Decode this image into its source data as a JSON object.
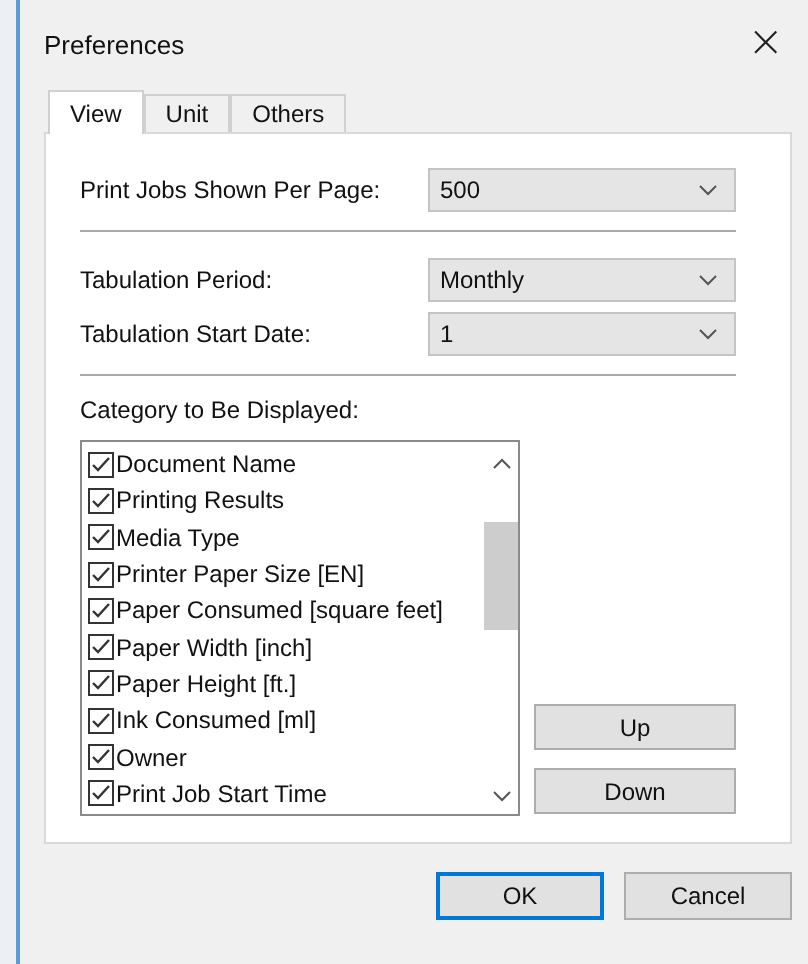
{
  "window": {
    "title": "Preferences",
    "close": "×"
  },
  "tabs": [
    {
      "label": "View",
      "selected": true
    },
    {
      "label": "Unit",
      "selected": false
    },
    {
      "label": "Others",
      "selected": false
    }
  ],
  "setting_groups": [
    [
      {
        "label": "Print Jobs Shown Per Page:",
        "value": "500"
      }
    ],
    [
      {
        "label": "Tabulation Period:",
        "value": "Monthly"
      },
      {
        "label": "Tabulation Start Date:",
        "value": "1"
      }
    ]
  ],
  "category": {
    "label": "Category to Be Displayed:",
    "items": [
      {
        "label": "Document Name",
        "checked": true
      },
      {
        "label": "Printing Results",
        "checked": true
      },
      {
        "label": "Media Type",
        "checked": true
      },
      {
        "label": "Printer Paper Size [EN]",
        "checked": true
      },
      {
        "label": "Paper Consumed [square feet]",
        "checked": true
      },
      {
        "label": "Paper Width [inch]",
        "checked": true
      },
      {
        "label": "Paper Height [ft.]",
        "checked": true
      },
      {
        "label": "Ink Consumed [ml]",
        "checked": true
      },
      {
        "label": "Owner",
        "checked": true
      },
      {
        "label": "Print Job Start Time",
        "checked": true
      }
    ],
    "move_buttons": [
      "Up",
      "Down"
    ]
  },
  "buttons": [
    {
      "label": "OK",
      "default": true
    },
    {
      "label": "Cancel",
      "default": false
    }
  ]
}
